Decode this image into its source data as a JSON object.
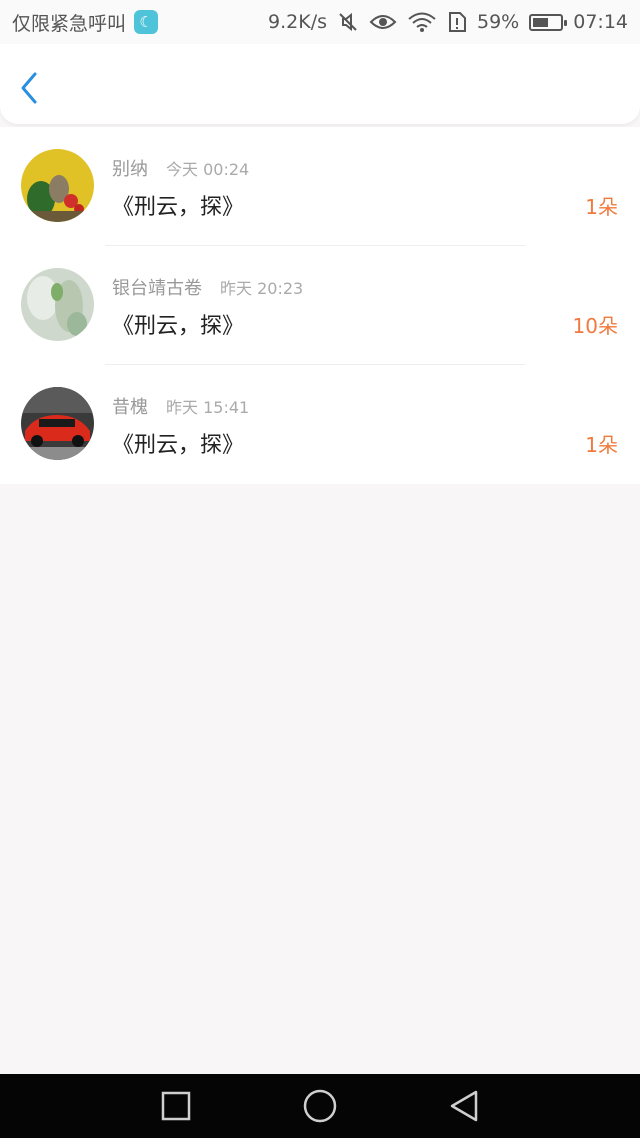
{
  "status_bar": {
    "carrier": "仅限紧急呼叫",
    "speed": "9.2K/s",
    "battery": "59%",
    "battery_level": 0.59,
    "time": "07:14"
  },
  "header": {
    "back_icon": "chevron-left-icon"
  },
  "rows": [
    {
      "user": "别纳",
      "time": "今天 00:24",
      "message": "《刑云，探》",
      "count": "1朵"
    },
    {
      "user": "银台靖古卷",
      "time": "昨天 20:23",
      "message": "《刑云，探》",
      "count": "10朵"
    },
    {
      "user": "昔槐",
      "time": "昨天 15:41",
      "message": "《刑云，探》",
      "count": "1朵"
    }
  ],
  "colors": {
    "accent": "#2a8fe0",
    "count": "#f07a3d"
  },
  "nav": {
    "icons": [
      "square-icon",
      "circle-icon",
      "triangle-back-icon"
    ]
  }
}
